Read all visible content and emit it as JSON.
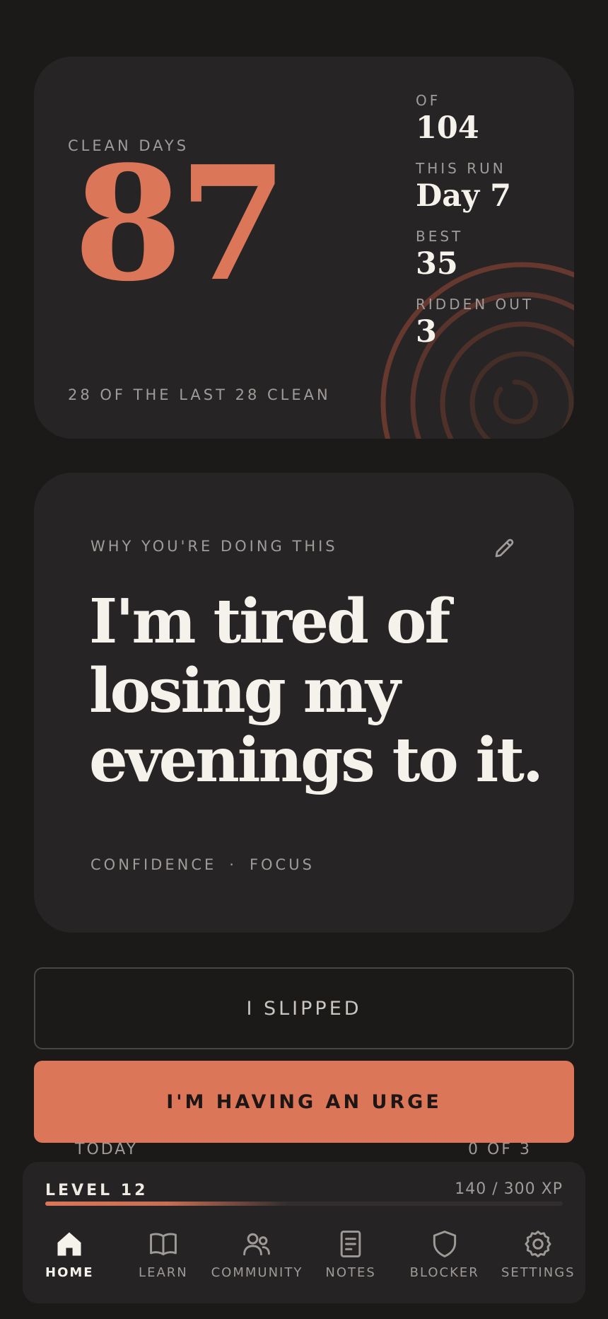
{
  "stats": {
    "clean_label": "Clean days",
    "clean_days": "87",
    "footer": "28 of the last 28 clean",
    "items": [
      {
        "label": "Of",
        "value": "104"
      },
      {
        "label": "This run",
        "value": "Day 7"
      },
      {
        "label": "Best",
        "value": "35"
      },
      {
        "label": "Ridden out",
        "value": "3"
      }
    ],
    "accent_color": "#dc7658"
  },
  "why": {
    "label": "Why you're doing this",
    "edit_icon": "pencil-icon",
    "quote": "I'm tired of losing my evenings to it.",
    "tags": [
      "Confidence",
      "·",
      "Focus"
    ]
  },
  "actions": {
    "slipped_label": "I slipped",
    "urge_label": "I'm having an urge"
  },
  "peek": {
    "left": "TODAY",
    "right": "0 OF 3"
  },
  "level": {
    "label": "Level 12",
    "xp_text": "140 / 300 XP",
    "xp_current": 140,
    "xp_total": 300
  },
  "nav": {
    "items": [
      {
        "label": "Home",
        "icon": "home-icon",
        "active": true
      },
      {
        "label": "Learn",
        "icon": "book-icon",
        "active": false
      },
      {
        "label": "Community",
        "icon": "people-icon",
        "active": false
      },
      {
        "label": "Notes",
        "icon": "note-icon",
        "active": false
      },
      {
        "label": "Blocker",
        "icon": "shield-icon",
        "active": false
      },
      {
        "label": "Settings",
        "icon": "gear-icon",
        "active": false
      }
    ]
  }
}
